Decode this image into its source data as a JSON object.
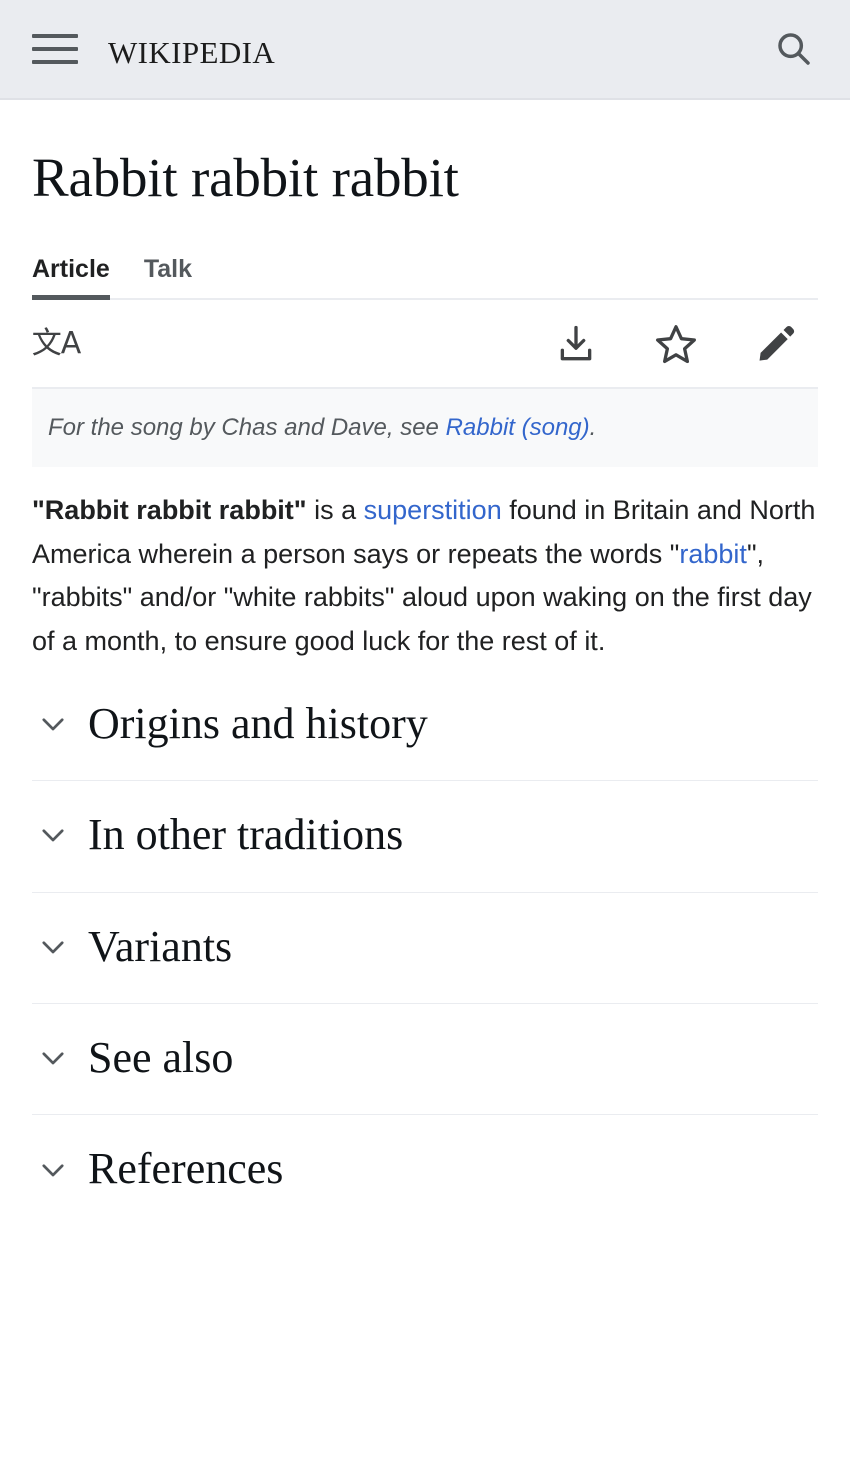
{
  "header": {
    "menu_icon": "hamburger-menu-icon",
    "wordmark": "Wikipedia",
    "search_icon": "search-icon"
  },
  "article": {
    "title": "Rabbit rabbit rabbit",
    "tabs": [
      {
        "label": "Article",
        "active": true
      },
      {
        "label": "Talk",
        "active": false
      }
    ],
    "actions": {
      "language": {
        "icon": "language-icon",
        "glyph": "文A"
      },
      "download": {
        "icon": "download-icon"
      },
      "watch": {
        "icon": "star-icon"
      },
      "edit": {
        "icon": "pencil-icon"
      }
    },
    "hatnote": {
      "before": "For the song by Chas and Dave, see ",
      "link": "Rabbit (song)",
      "after": "."
    },
    "lead": {
      "term": "\"Rabbit rabbit rabbit\"",
      "part1": " is a ",
      "link1": "superstition",
      "part2": " found in Britain and North America wherein a person says or repeats the words \"",
      "link2": "rabbit",
      "part3": "\", \"rabbits\" and/or \"white rabbits\" aloud upon waking on the first day of a month, to ensure good luck for the rest of it."
    },
    "sections": [
      {
        "title": "Origins and history",
        "expanded": false
      },
      {
        "title": "In other traditions",
        "expanded": false
      },
      {
        "title": "Variants",
        "expanded": false
      },
      {
        "title": "See also",
        "expanded": false
      },
      {
        "title": "References",
        "expanded": false
      }
    ]
  },
  "colors": {
    "header_bg": "#eaecf0",
    "link": "#3366cc",
    "text": "#202122",
    "muted": "#54595d",
    "divider": "#eaecf0",
    "hatnote_bg": "#f8f9fa"
  }
}
